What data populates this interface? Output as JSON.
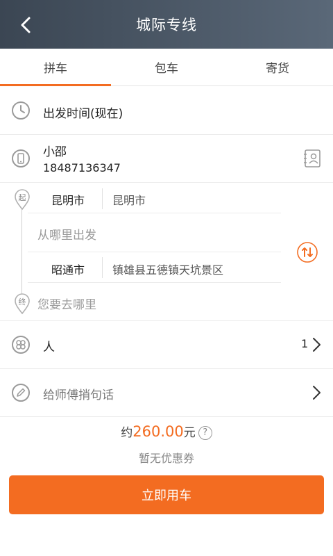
{
  "header": {
    "title": "城际专线"
  },
  "tabs": [
    {
      "label": "拼车",
      "active": true
    },
    {
      "label": "包车",
      "active": false
    },
    {
      "label": "寄货",
      "active": false
    }
  ],
  "departure_time": {
    "label": "出发时间(现在)"
  },
  "contact": {
    "name": "小邵",
    "phone": "18487136347"
  },
  "route": {
    "start_marker": "起",
    "end_marker": "终",
    "start_city": "昆明市",
    "start_city_value": "昆明市",
    "start_placeholder": "从哪里出发",
    "end_city": "昭通市",
    "end_city_value": "镇雄县五德镇天坑景区",
    "end_placeholder": "您要去哪里"
  },
  "passengers": {
    "label": "人",
    "count": "1"
  },
  "message": {
    "placeholder": "给师傅捎句话"
  },
  "price": {
    "prefix": "约",
    "amount": "260.00",
    "unit": "元",
    "help": "?"
  },
  "coupon": {
    "text": "暂无优惠券"
  },
  "submit": {
    "label": "立即用车"
  },
  "colors": {
    "accent": "#f36c21",
    "header": "#4a5663"
  }
}
